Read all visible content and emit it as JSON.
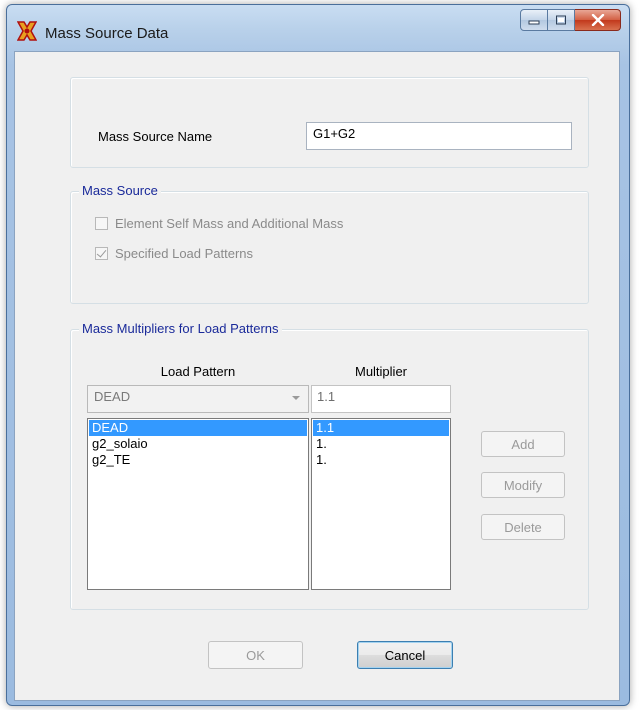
{
  "window": {
    "title": "Mass Source Data"
  },
  "name_section": {
    "label": "Mass Source Name",
    "value": "G1+G2"
  },
  "mass_source": {
    "title": "Mass Source",
    "options": [
      {
        "label": "Element Self Mass and Additional Mass",
        "checked": false,
        "enabled": false
      },
      {
        "label": "Specified Load Patterns",
        "checked": true,
        "enabled": false
      }
    ]
  },
  "multipliers": {
    "title": "Mass Multipliers for Load Patterns",
    "load_pattern_header": "Load Pattern",
    "multiplier_header": "Multiplier",
    "load_pattern_selected": "DEAD",
    "multiplier_value": "1.1",
    "rows": [
      {
        "pattern": "DEAD",
        "multiplier": "1.1",
        "selected": true
      },
      {
        "pattern": "g2_solaio",
        "multiplier": "1.",
        "selected": false
      },
      {
        "pattern": "g2_TE",
        "multiplier": "1.",
        "selected": false
      }
    ],
    "add_label": "Add",
    "modify_label": "Modify",
    "delete_label": "Delete"
  },
  "footer": {
    "ok_label": "OK",
    "cancel_label": "Cancel"
  },
  "colors": {
    "accent_title": "#1a2a9a",
    "selection": "#3399ff",
    "close_button": "#c2391c"
  }
}
